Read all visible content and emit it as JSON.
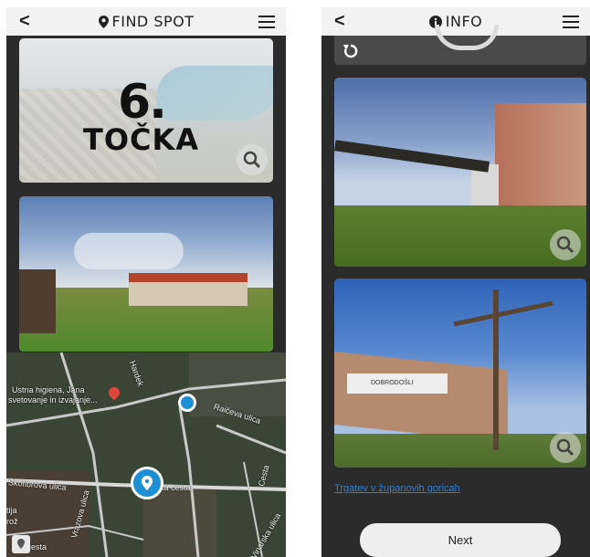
{
  "left": {
    "header": {
      "back": "<",
      "title": "FIND SPOT"
    },
    "hero": {
      "number": "6.",
      "word": "TOČKA"
    },
    "map": {
      "labels": [
        "Ustna higiena, Jana",
        "svetovanje in izvajanje...",
        "Hardek",
        "Raičeva ulica",
        "Škoﬁbrova ulica",
        "Vrazova ulica",
        "ka cesta",
        "Cesta",
        "Vinarska ulica",
        "ska cesta",
        "tija",
        "rož"
      ]
    }
  },
  "right": {
    "header": {
      "back": "<",
      "title": "INFO"
    },
    "link_text": "Trgatev v županovih goricah",
    "next_label": "Next",
    "banner_text": "DOBRODOŠLI"
  },
  "colors": {
    "pin": "#1e8fd4",
    "link": "#2f7fd4",
    "bar": "#f2f2f2",
    "bg": "#2b2b2b"
  }
}
